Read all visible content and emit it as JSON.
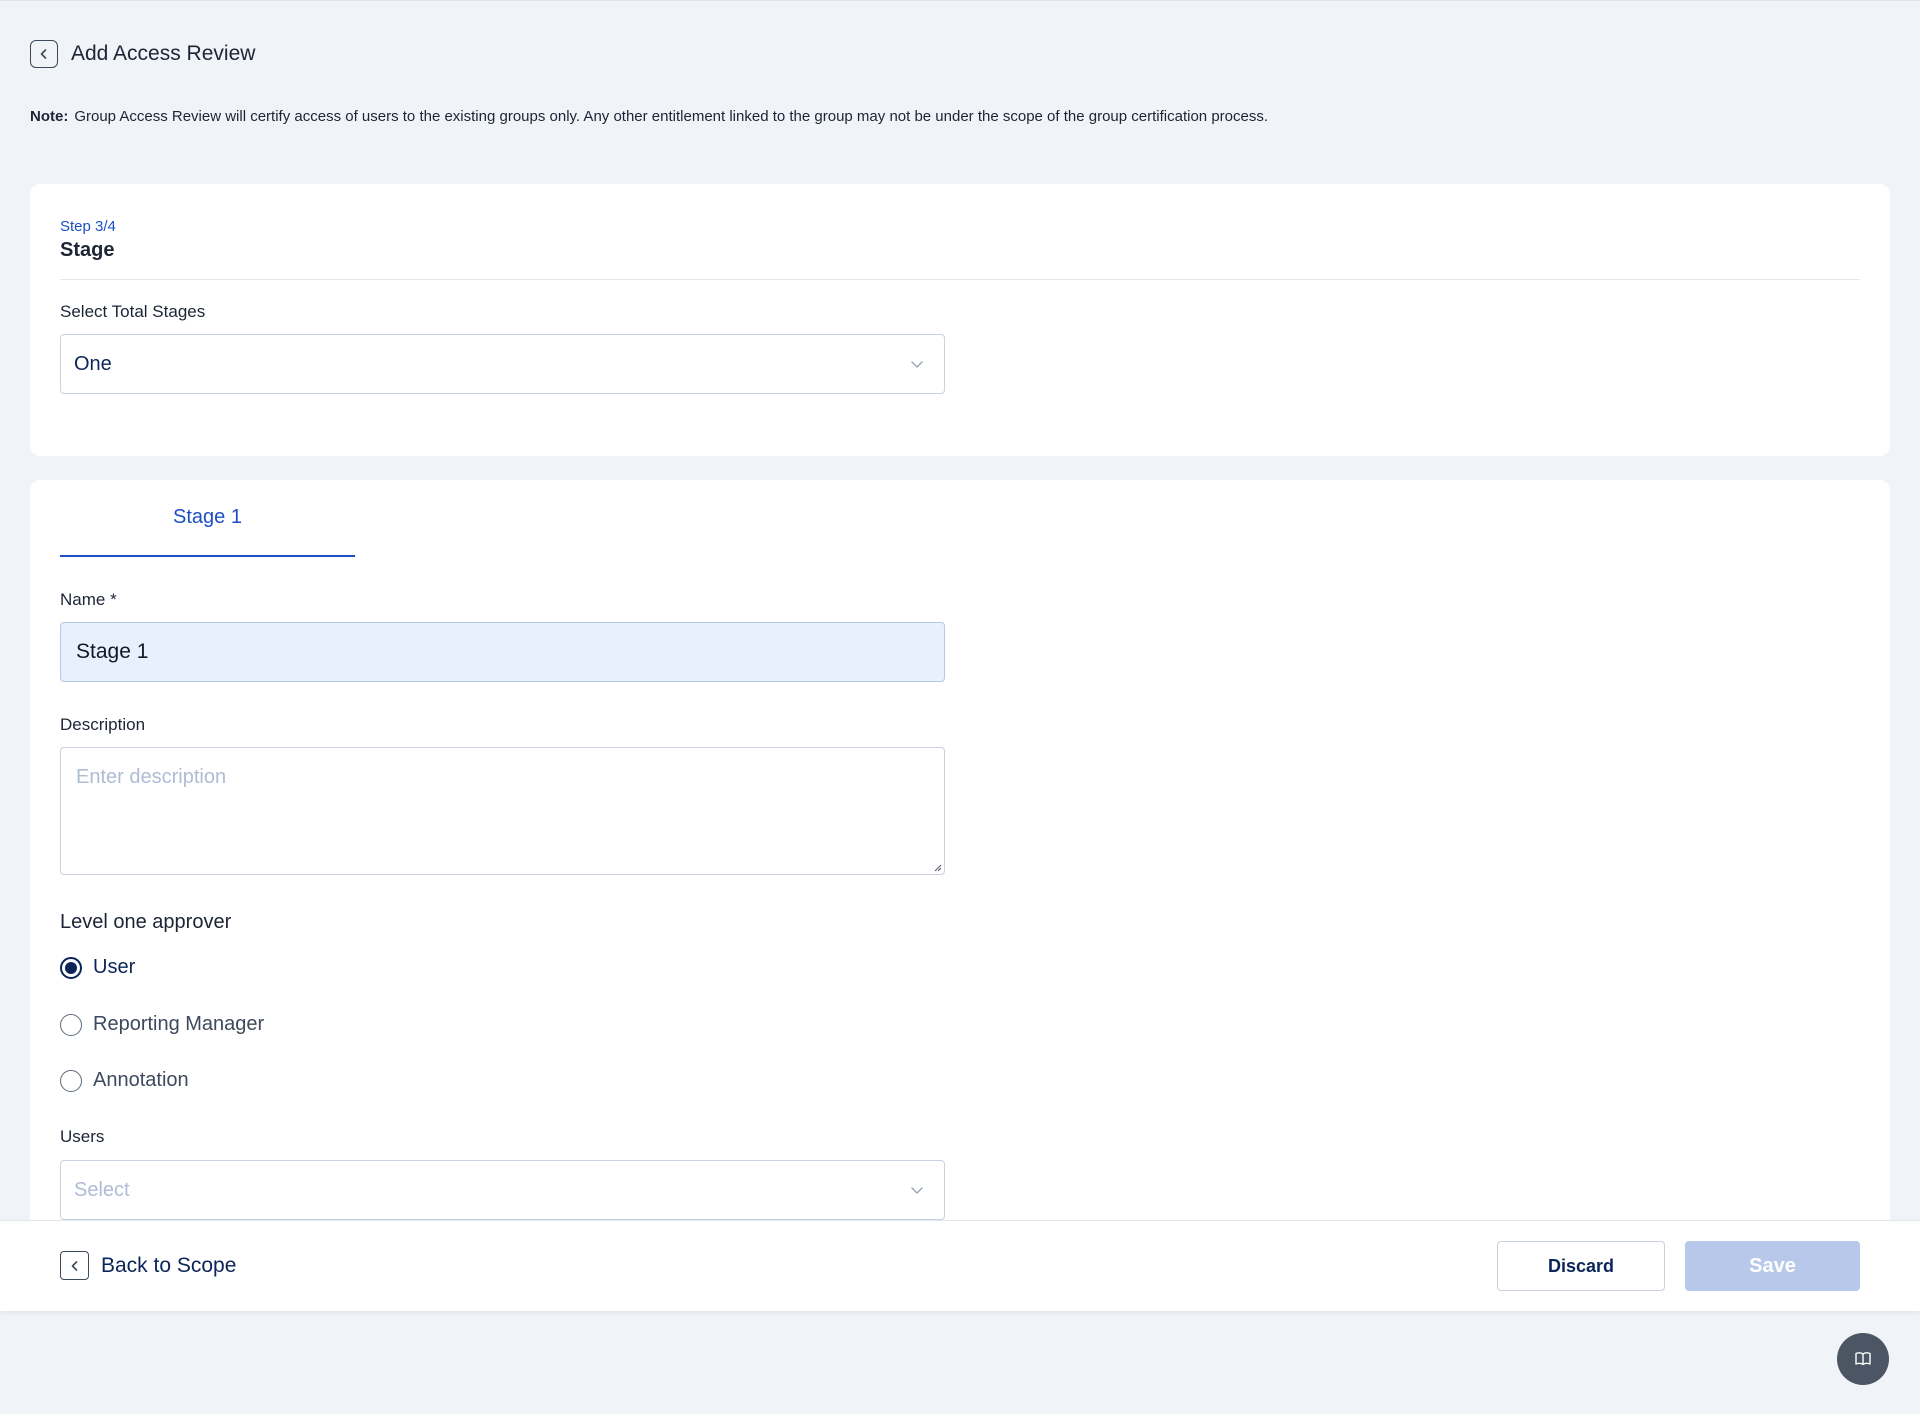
{
  "header": {
    "title": "Add Access Review"
  },
  "note": {
    "prefix": "Note:",
    "text": "Group Access Review will certify access of users to the existing groups only. Any other entitlement linked to the group may not be under the scope of the group certification process."
  },
  "step": {
    "label": "Step 3/4",
    "title": "Stage",
    "total_stages_label": "Select Total Stages",
    "total_stages_value": "One"
  },
  "stage_tabs": [
    {
      "label": "Stage 1",
      "active": true
    }
  ],
  "form": {
    "name_label": "Name *",
    "name_value": "Stage 1",
    "description_label": "Description",
    "description_placeholder": "Enter description",
    "approver_label": "Level one approver",
    "approver_options": [
      {
        "label": "User",
        "selected": true
      },
      {
        "label": "Reporting Manager",
        "selected": false
      },
      {
        "label": "Annotation",
        "selected": false
      }
    ],
    "users_label": "Users",
    "users_placeholder": "Select"
  },
  "footer": {
    "back_label": "Back to Scope",
    "discard_label": "Discard",
    "save_label": "Save"
  },
  "colors": {
    "accent": "#1d4fc4",
    "primary_dark": "#0b2558",
    "save_disabled": "#b7c8ea",
    "name_input_bg": "#e8effd",
    "page_bg": "#f0f3f7"
  },
  "icons": {
    "back": "chevron-left-icon",
    "dropdown": "chevron-down-icon",
    "help": "book-icon"
  }
}
